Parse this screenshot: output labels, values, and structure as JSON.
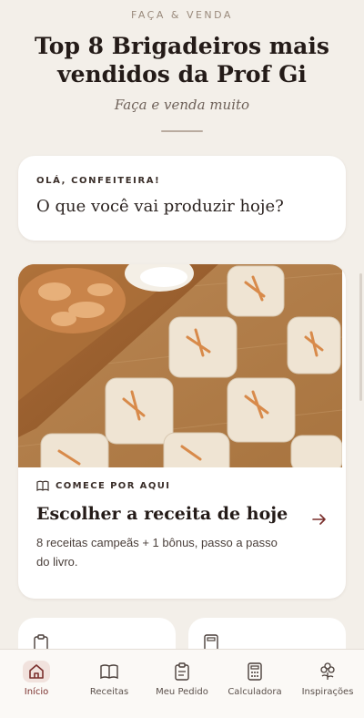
{
  "header": {
    "eyebrow": "FAÇA & VENDA",
    "title": "Top 8 Brigadeiros mais vendidos da Prof Gi",
    "subtitle": "Faça e venda muito"
  },
  "greeting": {
    "eyebrow": "OLÁ, CONFEITEIRA!",
    "question": "O que você vai produzir hoje?"
  },
  "recipe_card": {
    "start_label": "COMECE POR AQUI",
    "title": "Escolher a receita de hoje",
    "description": "8 receitas campeãs + 1 bônus, passo a passo do livro."
  },
  "nav": {
    "items": [
      {
        "label": "Início",
        "icon": "home-icon"
      },
      {
        "label": "Receitas",
        "icon": "book-icon"
      },
      {
        "label": "Meu Pedido",
        "icon": "clipboard-icon"
      },
      {
        "label": "Calculadora",
        "icon": "calculator-icon"
      },
      {
        "label": "Inspirações",
        "icon": "flower-icon"
      }
    ],
    "active": 0
  },
  "colors": {
    "background": "#f3efe9",
    "accent": "#7a2f2c",
    "active_bg": "#f1e2dd"
  }
}
